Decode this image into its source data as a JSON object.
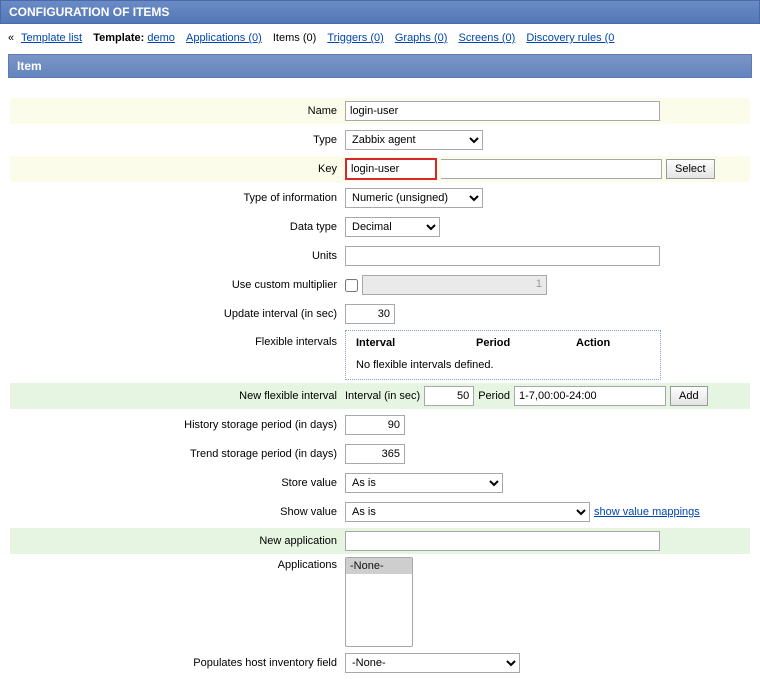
{
  "header": {
    "title": "CONFIGURATION OF ITEMS"
  },
  "breadcrumb": {
    "template_list": "Template list",
    "template_lbl": "Template:",
    "template_name": "demo",
    "applications": "Applications (0)",
    "items": "Items (0)",
    "triggers": "Triggers (0)",
    "graphs": "Graphs (0)",
    "screens": "Screens (0)",
    "discovery": "Discovery rules (0"
  },
  "section": {
    "title": "Item"
  },
  "labels": {
    "name": "Name",
    "type": "Type",
    "key": "Key",
    "type_info": "Type of information",
    "data_type": "Data type",
    "units": "Units",
    "use_mult": "Use custom multiplier",
    "update_int": "Update interval (in sec)",
    "flex_int": "Flexible intervals",
    "new_flex": "New flexible interval",
    "hist": "History storage period (in days)",
    "trend": "Trend storage period (in days)",
    "store": "Store value",
    "show": "Show value",
    "new_app": "New application",
    "apps": "Applications",
    "pop": "Populates host inventory field"
  },
  "values": {
    "name": "login-user",
    "type": "Zabbix agent",
    "key": "login-user",
    "type_info": "Numeric (unsigned)",
    "data_type": "Decimal",
    "units": "",
    "multiplier": "1",
    "update_int": "30",
    "new_flex_int": "50",
    "new_flex_period": "1-7,00:00-24:00",
    "hist": "90",
    "trend": "365",
    "store": "As is",
    "show": "As is",
    "new_app": "",
    "apps_opt": "-None-",
    "pop": "-None-"
  },
  "buttons": {
    "select": "Select",
    "add": "Add"
  },
  "flex": {
    "h_interval": "Interval",
    "h_period": "Period",
    "h_action": "Action",
    "msg": "No flexible intervals defined."
  },
  "inline": {
    "interval_lbl": "Interval (in sec)",
    "period_lbl": "Period",
    "show_map": "show value mappings"
  }
}
